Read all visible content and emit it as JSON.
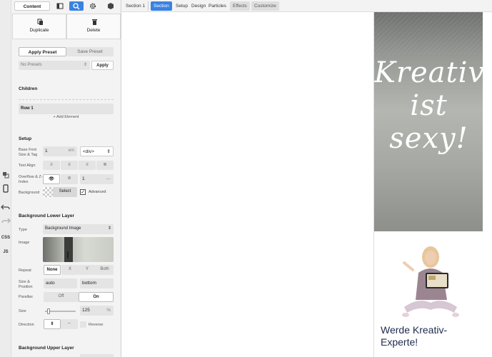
{
  "rail": {
    "icons": [
      "multi-select-icon",
      "mobile-icon",
      "undo-icon",
      "redo-icon"
    ],
    "css_label": "CSS",
    "js_label": "JS"
  },
  "panel_tabs": {
    "content": "Content",
    "icons": [
      "layout-toggle-icon",
      "search-icon",
      "settings-icon",
      "cube-icon"
    ]
  },
  "actions": {
    "duplicate": "Duplicate",
    "delete": "Delete"
  },
  "preset": {
    "apply_preset": "Apply Preset",
    "save_preset": "Save Preset",
    "select_value": "No Presets",
    "apply_button": "Apply"
  },
  "children": {
    "heading": "Children",
    "items": [
      "Row 1"
    ],
    "add_element": "+ Add Element"
  },
  "setup": {
    "heading": "Setup",
    "base_font_label": "Base Font Size & Tag",
    "base_font_value": "1",
    "base_font_unit": "em",
    "tag_value": "<div>",
    "text_align_label": "Text Align",
    "overflow_label": "Overflow & Z-Index",
    "zindex_value": "1",
    "zindex_more": "···",
    "background_label": "Background",
    "select_button": "Select",
    "advanced_label": "Advanced",
    "advanced_checked": true
  },
  "lower_layer": {
    "heading": "Background Lower Layer",
    "type_label": "Type",
    "type_value": "Background Image",
    "image_label": "Image",
    "repeat_label": "Repeat",
    "repeat_options": [
      "None",
      "X",
      "Y",
      "Both"
    ],
    "repeat_selected": "None",
    "size_label": "Size & Position",
    "size_value": "auto",
    "position_value": "bottom",
    "parallax_label": "Parallax",
    "parallax_options": [
      "Off",
      "On"
    ],
    "parallax_selected": "On",
    "size2_label": "Size",
    "size2_value": "125",
    "size2_unit": "%",
    "slider_fraction": 0.08,
    "direction_label": "Direction",
    "reverse_label": "Reverse"
  },
  "upper_layer": {
    "heading": "Background Upper Layer"
  },
  "topbar": {
    "crumb": "Section 1",
    "tabs": [
      "Section",
      "Setup",
      "Design",
      "Particles",
      "Effects",
      "Customize"
    ],
    "active_tab": "Section"
  },
  "preview": {
    "script_lines": [
      "Kreativ",
      "ist",
      "sexy!"
    ],
    "headline_line1": "Werde Kreativ-",
    "headline_line2": "Experte!"
  },
  "colors": {
    "accent": "#3b82e0",
    "headline": "#1d2a4d"
  }
}
